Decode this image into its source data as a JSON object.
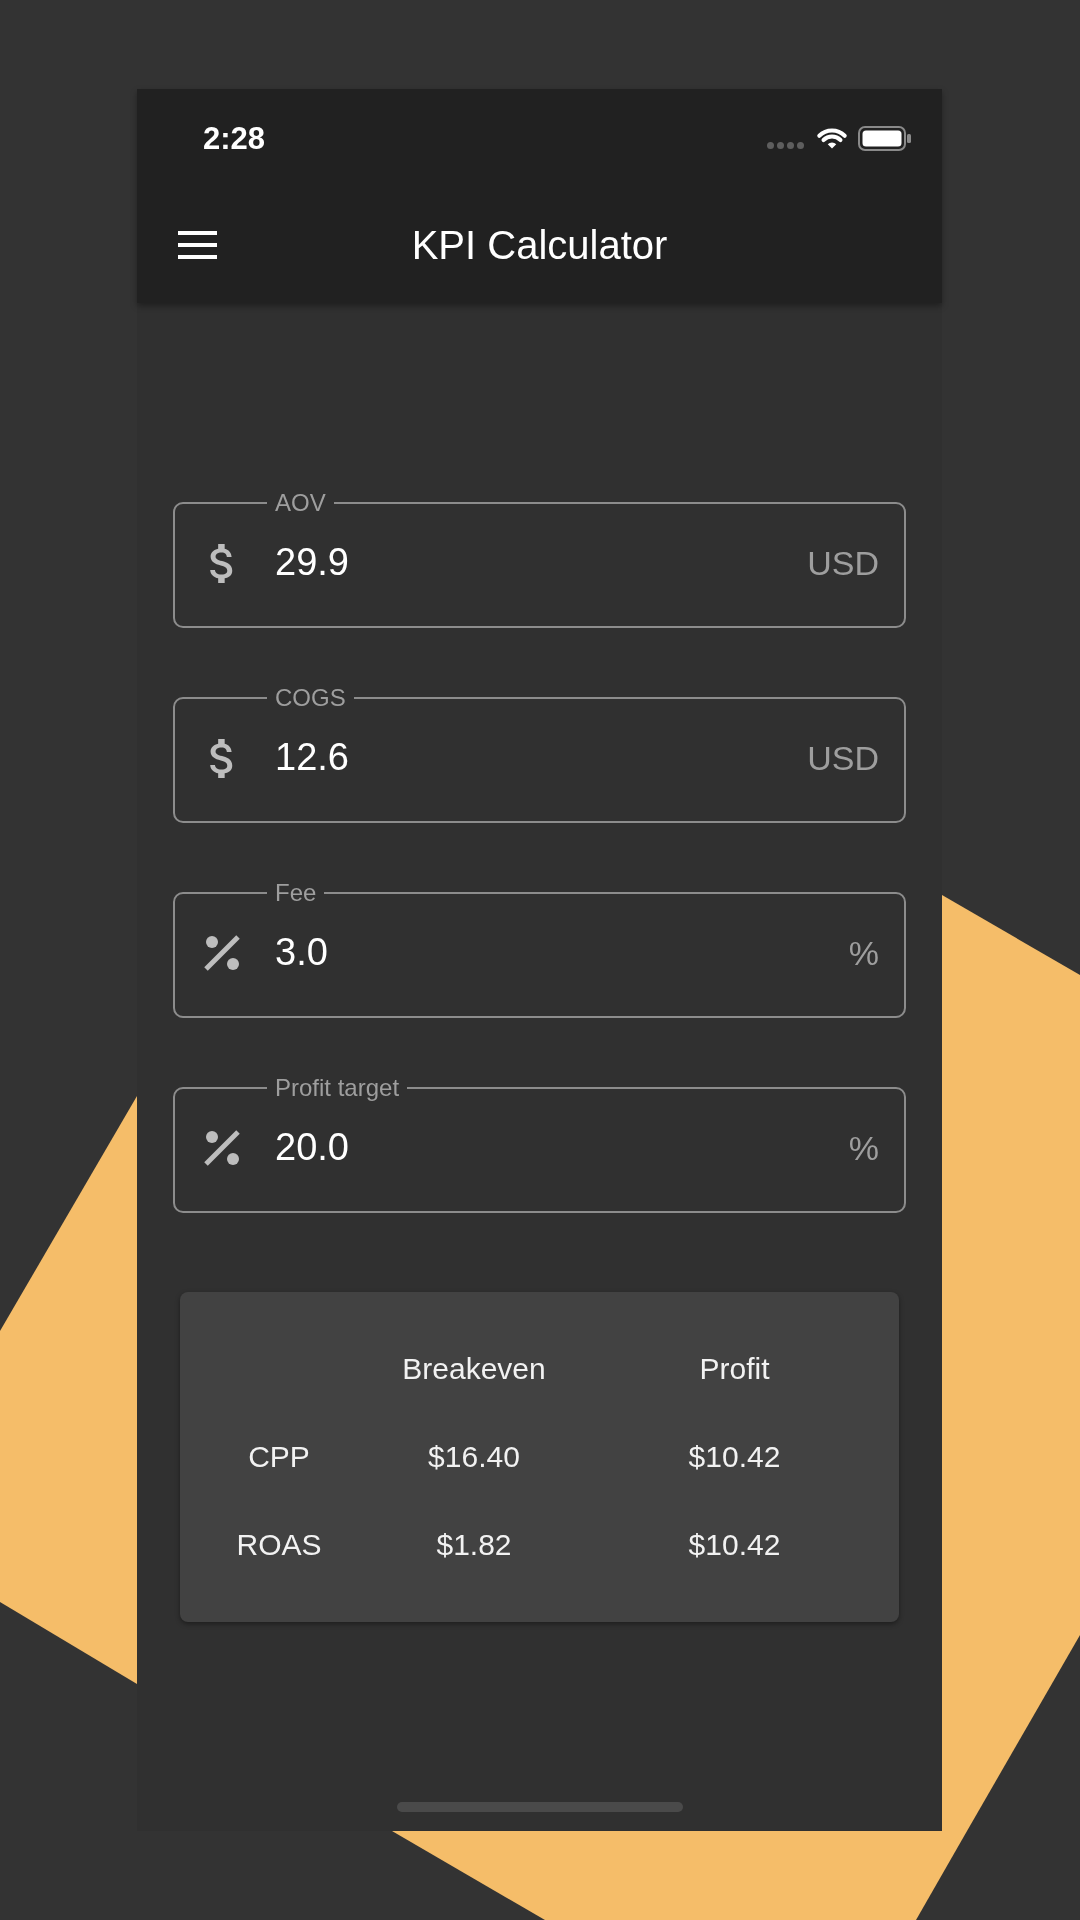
{
  "status_bar": {
    "time": "2:28"
  },
  "app_bar": {
    "title": "KPI Calculator"
  },
  "fields": [
    {
      "label": "AOV",
      "kind": "currency",
      "value": "29.9",
      "suffix": "USD"
    },
    {
      "label": "COGS",
      "kind": "currency",
      "value": "12.6",
      "suffix": "USD"
    },
    {
      "label": "Fee",
      "kind": "percent",
      "value": "3.0",
      "suffix": "%"
    },
    {
      "label": "Profit target",
      "kind": "percent",
      "value": "20.0",
      "suffix": "%"
    }
  ],
  "results": {
    "columns": [
      "Breakeven",
      "Profit"
    ],
    "rows": [
      {
        "label": "CPP",
        "values": [
          "$16.40",
          "$10.42"
        ]
      },
      {
        "label": "ROAS",
        "values": [
          "$1.82",
          "$10.42"
        ]
      }
    ]
  }
}
